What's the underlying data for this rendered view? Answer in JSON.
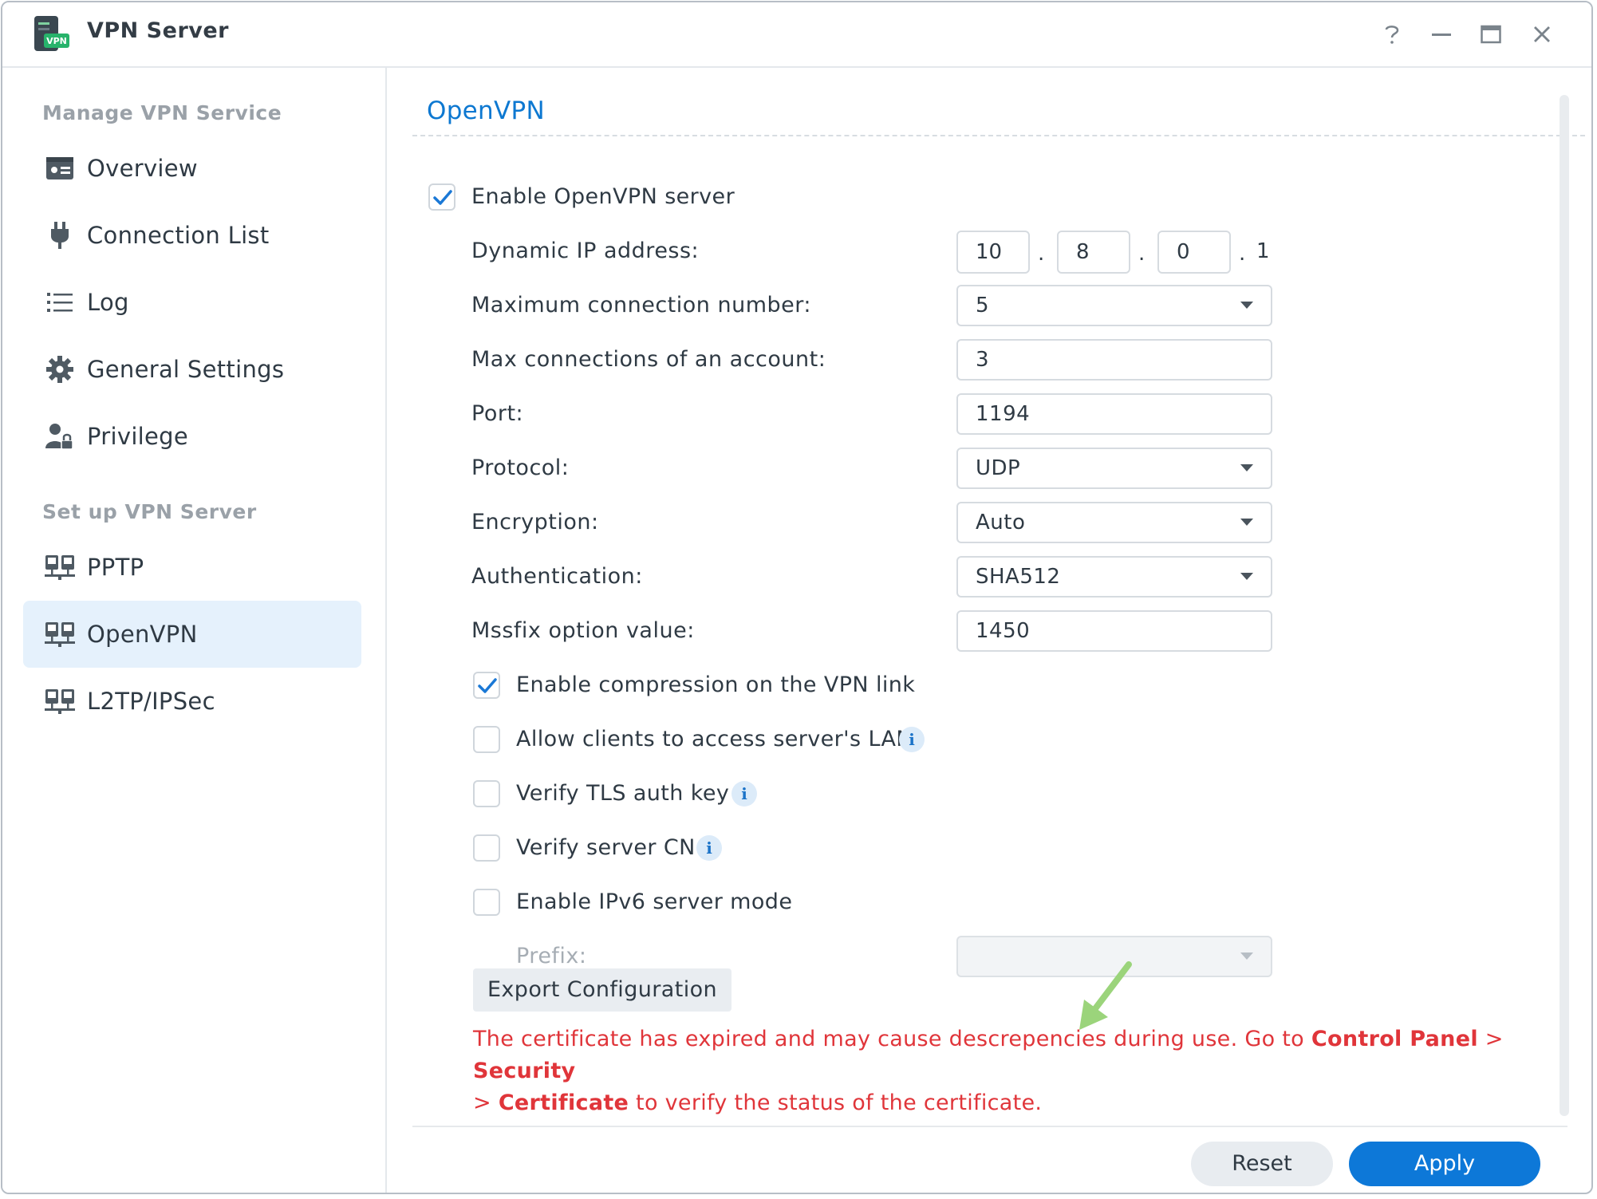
{
  "window": {
    "title": "VPN Server",
    "app_icon_badge": "VPN"
  },
  "titlebar_controls": [
    "help-icon",
    "minimize-icon",
    "maximize-icon",
    "close-icon"
  ],
  "sidebar": {
    "section1": "Manage VPN Service",
    "manage_items": [
      {
        "label": "Overview",
        "icon": "overview-card-icon"
      },
      {
        "label": "Connection List",
        "icon": "plug-icon"
      },
      {
        "label": "Log",
        "icon": "list-icon"
      },
      {
        "label": "General Settings",
        "icon": "gear-icon"
      },
      {
        "label": "Privilege",
        "icon": "user-lock-icon"
      }
    ],
    "section2": "Set up VPN Server",
    "setup_items": [
      {
        "label": "PPTP",
        "icon": "network-icon",
        "active": false
      },
      {
        "label": "OpenVPN",
        "icon": "network-icon",
        "active": true
      },
      {
        "label": "L2TP/IPSec",
        "icon": "network-icon",
        "active": false
      }
    ]
  },
  "main": {
    "title": "OpenVPN",
    "enable_server": {
      "label": "Enable OpenVPN server",
      "checked": true
    },
    "dynamic_ip": {
      "label": "Dynamic IP address:",
      "octet1": "10",
      "octet2": "8",
      "octet3": "0",
      "octet4": "1",
      "dot": "."
    },
    "max_conn": {
      "label": "Maximum connection number:",
      "value": "5"
    },
    "max_conn_account": {
      "label": "Max connections of an account:",
      "value": "3"
    },
    "port": {
      "label": "Port:",
      "value": "1194"
    },
    "protocol": {
      "label": "Protocol:",
      "value": "UDP"
    },
    "encryption": {
      "label": "Encryption:",
      "value": "Auto"
    },
    "authentication": {
      "label": "Authentication:",
      "value": "SHA512"
    },
    "mssfix": {
      "label": "Mssfix option value:",
      "value": "1450"
    },
    "compression": {
      "label": "Enable compression on the VPN link",
      "checked": true
    },
    "allow_lan": {
      "label": "Allow clients to access server's LAN",
      "checked": false
    },
    "verify_tls": {
      "label": "Verify TLS auth key",
      "checked": false
    },
    "verify_cn": {
      "label": "Verify server CN",
      "checked": false
    },
    "ipv6": {
      "label": "Enable IPv6 server mode",
      "checked": false
    },
    "prefix": {
      "label": "Prefix:",
      "value": ""
    },
    "info_glyph": "i",
    "export_button": "Export Configuration",
    "warning": {
      "text1": "The certificate has expired and may cause descrepencies during use. Go to ",
      "link1": "Control Panel",
      "sep1": " > ",
      "link2": "Security",
      "sep2": " > ",
      "link3": "Certificate",
      "text2": " to verify the status of the certificate."
    }
  },
  "footer": {
    "reset": "Reset",
    "apply": "Apply"
  },
  "colors": {
    "accent": "#0d78d8",
    "title_blue": "#0d78d1",
    "warning_red": "#e0353a",
    "active_bg": "#e5f1fc",
    "arrow_green": "#9bd47b"
  }
}
